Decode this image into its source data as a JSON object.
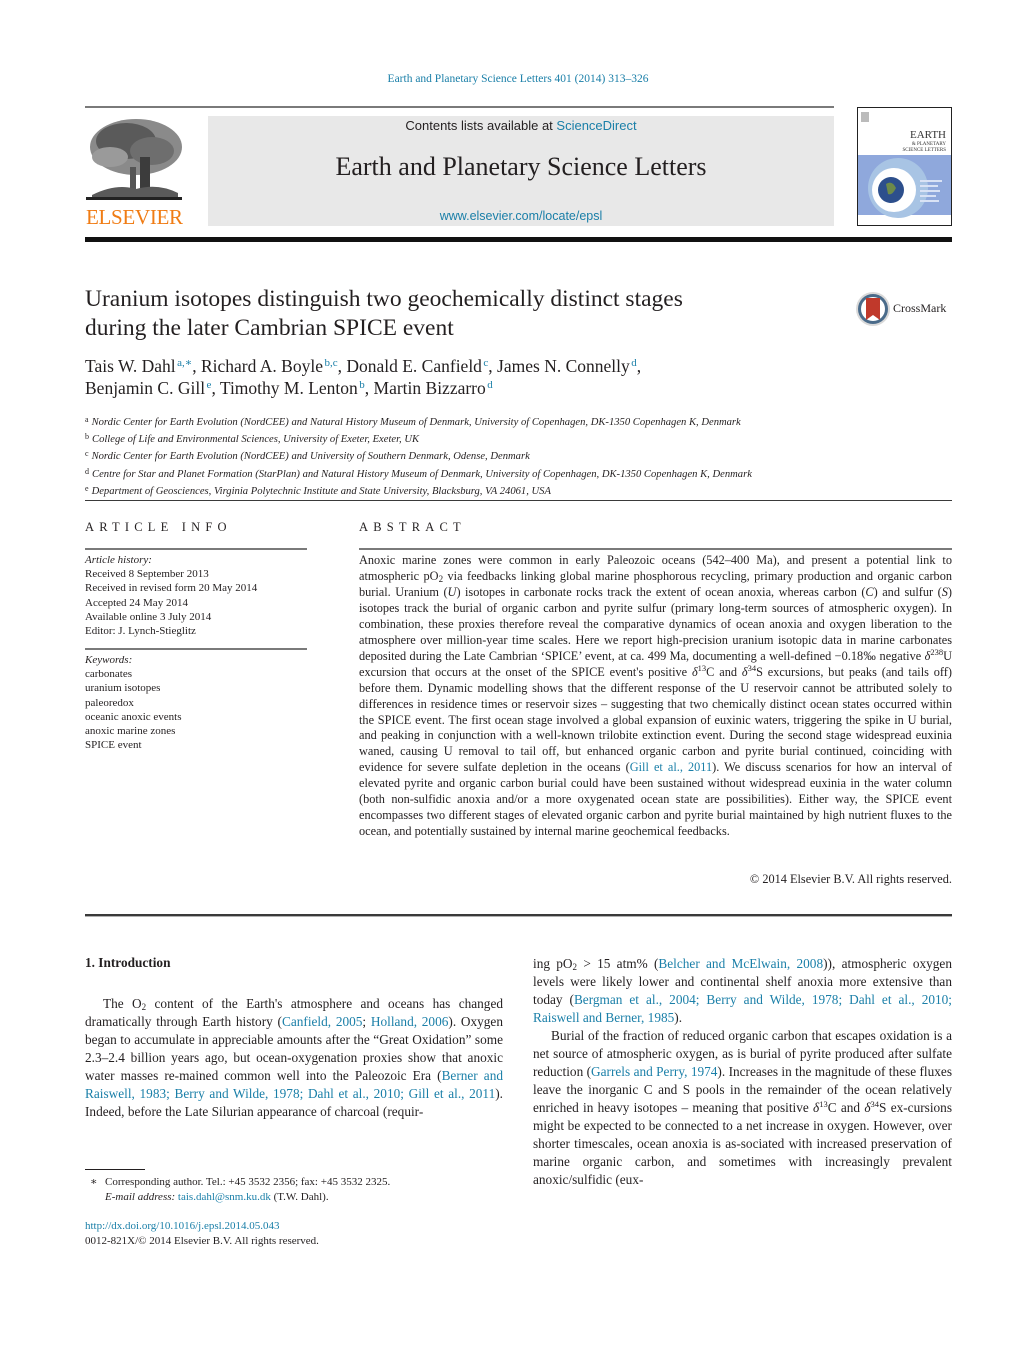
{
  "citation": "Earth and Planetary Science Letters 401 (2014) 313–326",
  "header": {
    "contents_prefix": "Contents lists available at ",
    "contents_link": "ScienceDirect",
    "journal_title": "Earth and Planetary Science Letters",
    "journal_url": "www.elsevier.com/locate/epsl",
    "publisher_logo_text": "ELSEVIER",
    "cover_title_line1": "EARTH",
    "cover_title_line2": "& PLANETARY",
    "cover_title_line3": "SCIENCE LETTERS",
    "colors": {
      "link": "#1a7fa8",
      "elsevier_orange": "#f07c14",
      "header_band": "#e8e8e8",
      "cover_blue": "#8fa8dc"
    }
  },
  "article": {
    "title_line1": "Uranium isotopes distinguish two geochemically distinct stages",
    "title_line2": "during the later Cambrian SPICE event",
    "crossmark_label": "CrossMark",
    "authors_line1": [
      {
        "name": "Tais W. Dahl",
        "aff": "a,∗",
        "sep": ", "
      },
      {
        "name": "Richard A. Boyle",
        "aff": "b,c",
        "sep": ", "
      },
      {
        "name": "Donald E. Canfield",
        "aff": "c",
        "sep": ", "
      },
      {
        "name": "James N. Connelly",
        "aff": "d",
        "sep": ","
      }
    ],
    "authors_line2": [
      {
        "name": "Benjamin C. Gill",
        "aff": "e",
        "sep": ", "
      },
      {
        "name": "Timothy M. Lenton",
        "aff": "b",
        "sep": ", "
      },
      {
        "name": "Martin Bizzarro",
        "aff": "d",
        "sep": ""
      }
    ],
    "affiliations": [
      {
        "label": "a",
        "text": "Nordic Center for Earth Evolution (NordCEE) and Natural History Museum of Denmark, University of Copenhagen, DK-1350 Copenhagen K, Denmark"
      },
      {
        "label": "b",
        "text": "College of Life and Environmental Sciences, University of Exeter, Exeter, UK"
      },
      {
        "label": "c",
        "text": "Nordic Center for Earth Evolution (NordCEE) and University of Southern Denmark, Odense, Denmark"
      },
      {
        "label": "d",
        "text": "Centre for Star and Planet Formation (StarPlan) and Natural History Museum of Denmark, University of Copenhagen, DK-1350 Copenhagen K, Denmark"
      },
      {
        "label": "e",
        "text": "Department of Geosciences, Virginia Polytechnic Institute and State University, Blacksburg, VA 24061, USA"
      }
    ]
  },
  "article_info": {
    "heading": "ARTICLE INFO",
    "history_label": "Article history:",
    "history": [
      "Received 8 September 2013",
      "Received in revised form 20 May 2014",
      "Accepted 24 May 2014",
      "Available online 3 July 2014",
      "Editor: J. Lynch-Stieglitz"
    ],
    "keywords_label": "Keywords:",
    "keywords": [
      "carbonates",
      "uranium isotopes",
      "paleoredox",
      "oceanic anoxic events",
      "anoxic marine zones",
      "SPICE event"
    ]
  },
  "abstract": {
    "heading": "ABSTRACT",
    "p1": "Anoxic marine zones were common in early Paleozoic oceans (542–400 Ma), and present a potential link to atmospheric pO",
    "p1_sub": "2",
    "p2": " via feedbacks linking global marine phosphorous recycling, primary production and organic carbon burial. Uranium (",
    "p2_u": "U",
    "p3": ") isotopes in carbonate rocks track the extent of ocean anoxia, whereas carbon (",
    "p3_c": "C",
    "p4": ") and sulfur (",
    "p4_s": "S",
    "p5": ") isotopes track the burial of organic carbon and pyrite sulfur (primary long-term sources of atmospheric oxygen). In combination, these proxies therefore reveal the comparative dynamics of ocean anoxia and oxygen liberation to the atmosphere over million-year time scales. Here we report high-precision uranium isotopic data in marine carbonates deposited during the Late Cambrian ‘SPICE’ event, at ca. 499 Ma, documenting a well-defined −0.18‰ negative ",
    "delta": "δ",
    "sup238": "238",
    "p6": "U excursion that occurs at the onset of the SPICE event's positive ",
    "sup13": "13",
    "p7": "C and ",
    "sup34": "34",
    "p8": "S excursions, but peaks (and tails off) before them. Dynamic modelling shows that the different response of the U reservoir cannot be attributed solely to differences in residence times or reservoir sizes – suggesting that two chemically distinct ocean states occurred within the SPICE event. The first ocean stage involved a global expansion of euxinic waters, triggering the spike in U burial, and peaking in conjunction with a well-known trilobite extinction event. During the second stage widespread euxinia waned, causing U removal to tail off, but enhanced organic carbon and pyrite burial continued, coinciding with evidence for severe sulfate depletion in the oceans (",
    "ref_gill": "Gill et al., 2011",
    "p9": "). We discuss scenarios for how an interval of elevated pyrite and organic carbon burial could have been sustained without widespread euxinia in the water column (both non-sulfidic anoxia and/or a more oxygenated ocean state are possibilities). Either way, the SPICE event encompasses two different stages of elevated organic carbon and pyrite burial maintained by high nutrient fluxes to the ocean, and potentially sustained by internal marine geochemical feedbacks.",
    "copyright": "© 2014 Elsevier B.V. All rights reserved."
  },
  "body": {
    "section_heading": "1. Introduction",
    "left": {
      "t1": "The O",
      "t1_sub": "2",
      "t2": " content of the Earth's atmosphere and oceans has changed dramatically through Earth history (",
      "r1": "Canfield, 2005",
      "t3": "; ",
      "r2": "Holland, 2006",
      "t4": "). Oxygen began to accumulate in appreciable amounts after the “Great Oxidation” some 2.3–2.4 billion years ago, but ocean-oxygenation proxies show that anoxic water masses re-mained common well into the Paleozoic Era (",
      "r3": "Berner and Raiswell, 1983; Berry and Wilde, 1978; Dahl et al., 2010; Gill et al., 2011",
      "t5": "). Indeed, before the Late Silurian appearance of charcoal (requir-"
    },
    "right": {
      "t1": "ing pO",
      "t1_sub": "2",
      "t2": " > 15 atm% (",
      "r1": "Belcher and McElwain, 2008",
      "t3": ")), atmospheric oxygen levels were likely lower and continental shelf anoxia more extensive than today (",
      "r2": "Bergman et al., 2004; Berry and Wilde, 1978; Dahl et al., 2010; Raiswell and Berner, 1985",
      "t4": ").",
      "p2a": "Burial of the fraction of reduced organic carbon that escapes oxidation is a net source of atmospheric oxygen, as is burial of pyrite produced after sulfate reduction (",
      "r3": "Garrels and Perry, 1974",
      "p2b": "). Increases in the magnitude of these fluxes leave the inorganic C and S pools in the remainder of the ocean relatively enriched in heavy isotopes – meaning that positive ",
      "delta": "δ",
      "sup13": "13",
      "p2c": "C and ",
      "sup34": "34",
      "p2d": "S ex-cursions might be expected to be connected to a net increase in oxygen. However, over shorter timescales, ocean anoxia is as-sociated with increased preservation of marine organic carbon, and sometimes with increasingly prevalent anoxic/sulfidic (eux-"
    }
  },
  "footnote": {
    "star": "∗",
    "line1": "Corresponding author. Tel.: +45 3532 2356; fax: +45 3532 2325.",
    "email_label": "E-mail address:",
    "email": "tais.dahl@snm.ku.dk",
    "email_suffix": " (T.W. Dahl).",
    "doi": "http://dx.doi.org/10.1016/j.epsl.2014.05.043",
    "issn_copyright": "0012-821X/© 2014 Elsevier B.V. All rights reserved."
  }
}
